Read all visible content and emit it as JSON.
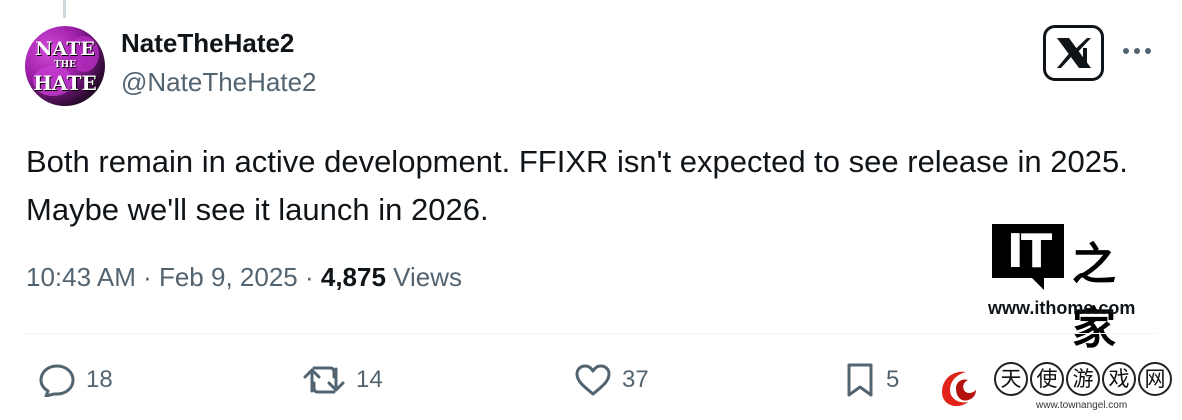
{
  "author": {
    "display_name": "NateTheHate2",
    "handle": "@NateTheHate2",
    "avatar_text": [
      "NATE",
      "THE",
      "HATE"
    ]
  },
  "tweet": {
    "text": "Both remain in active development. FFIXR isn't expected to see release in 2025. Maybe we'll see it launch in 2026."
  },
  "meta": {
    "time": "10:43 AM",
    "separator": " · ",
    "date": "Feb 9, 2025",
    "views_count": "4,875",
    "views_label": " Views"
  },
  "actions": {
    "replies": "18",
    "reposts": "14",
    "likes": "37",
    "bookmarks": "5"
  },
  "watermarks": {
    "ithome_logo_text": "IT",
    "ithome_chinese": "之家",
    "ithome_url": "www.ithome.com",
    "townangel_chars": [
      "天",
      "使",
      "游",
      "戏",
      "网"
    ],
    "townangel_url": "www.townangel.com"
  },
  "colors": {
    "text_primary": "#0f1419",
    "text_secondary": "#536471",
    "divider": "#eff3f4"
  },
  "icons": [
    "x-logo-icon",
    "more-icon",
    "reply-icon",
    "repost-icon",
    "like-icon",
    "bookmark-icon"
  ]
}
